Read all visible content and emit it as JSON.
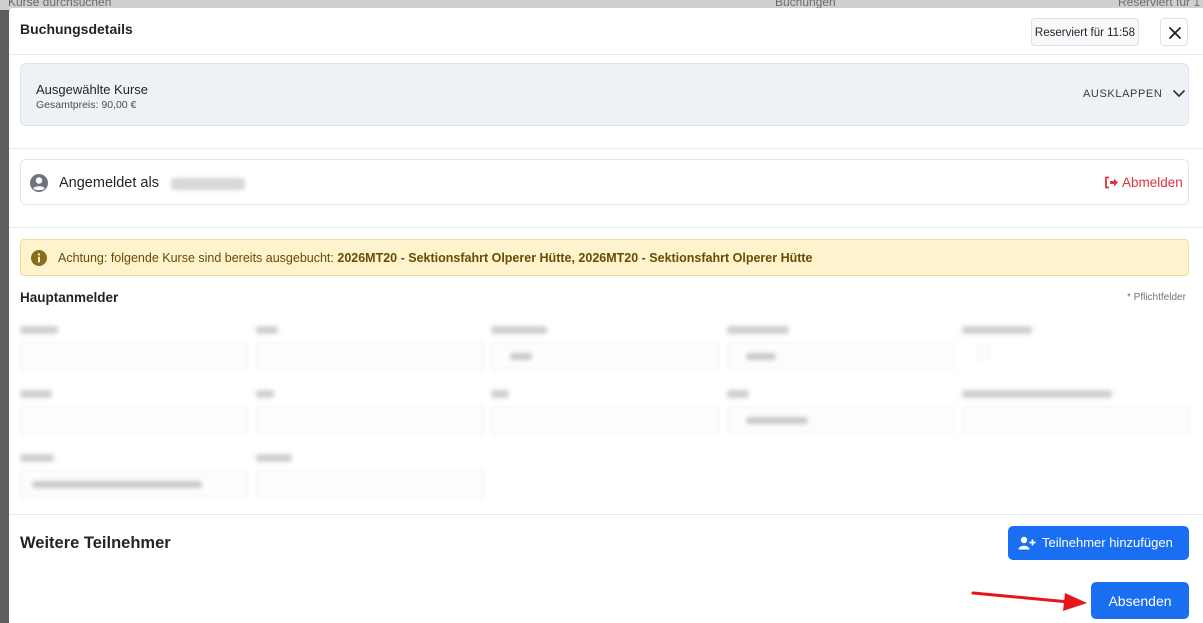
{
  "background": {
    "left_text": "Kurse durchsuchen",
    "center_text": "Buchungen",
    "right_text": "Reserviert für 1"
  },
  "modal": {
    "title": "Buchungsdetails",
    "reserved_label": "Reserviert für 11:58"
  },
  "courses": {
    "title": "Ausgewählte Kurse",
    "total_price": "Gesamtpreis: 90,00 €",
    "expand_label": "AUSKLAPPEN"
  },
  "login": {
    "label": "Angemeldet als",
    "logout_label": "Abmelden"
  },
  "alert": {
    "prefix": "Achtung: folgende Kurse sind bereits ausgebucht:",
    "courses": "2026MT20 - Sektionsfahrt Olperer Hütte, 2026MT20 - Sektionsfahrt Olperer Hütte"
  },
  "main_registrant": {
    "title": "Hauptanmelder",
    "required_note": "* Pflichtfelder"
  },
  "further_participants": {
    "title": "Weitere Teilnehmer",
    "add_button": "Teilnehmer hinzufügen"
  },
  "submit_button": "Absenden",
  "colors": {
    "primary": "#1a6ef2",
    "danger": "#dc3545",
    "warning_bg": "#fff3cd",
    "annotation_arrow": "#e8141b"
  }
}
